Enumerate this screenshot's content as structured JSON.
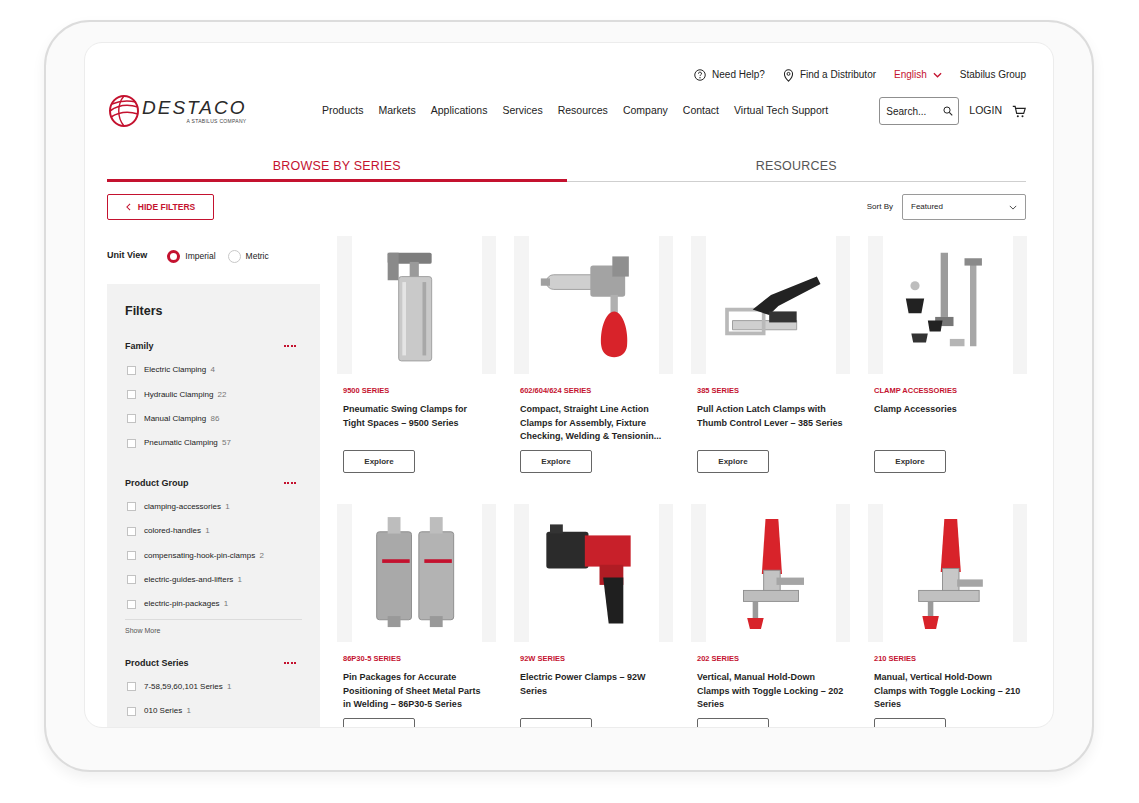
{
  "utility_bar": {
    "help": "Need Help?",
    "distributor": "Find a Distributor",
    "language": "English",
    "group": "Stabilus Group"
  },
  "logo": {
    "name": "DESTACO",
    "tagline": "A STABILUS COMPANY"
  },
  "nav": [
    "Products",
    "Markets",
    "Applications",
    "Services",
    "Resources",
    "Company",
    "Contact",
    "Virtual Tech Support"
  ],
  "search": {
    "placeholder": "Search..."
  },
  "login": "LOGIN",
  "tabs": [
    {
      "label": "BROWSE BY SERIES",
      "selected": true
    },
    {
      "label": "RESOURCES",
      "selected": false
    }
  ],
  "hide_filters": "HIDE FILTERS",
  "sort": {
    "label": "Sort By",
    "value": "Featured"
  },
  "unit_view": {
    "label": "Unit View",
    "options": [
      {
        "label": "Imperial",
        "selected": true
      },
      {
        "label": "Metric",
        "selected": false
      }
    ]
  },
  "filters": {
    "title": "Filters",
    "groups": [
      {
        "title": "Family",
        "items": [
          {
            "label": "Electric Clamping",
            "count": "4",
            "checked": false
          },
          {
            "label": "Hydraulic Clamping",
            "count": "22",
            "checked": false
          },
          {
            "label": "Manual Clamping",
            "count": "86",
            "checked": false
          },
          {
            "label": "Pneumatic Clamping",
            "count": "57",
            "checked": false
          }
        ]
      },
      {
        "title": "Product Group",
        "show_more": "Show More",
        "items": [
          {
            "label": "clamping-accessories",
            "count": "1",
            "checked": false
          },
          {
            "label": "colored-handles",
            "count": "1",
            "checked": false
          },
          {
            "label": "compensating-hook-pin-clamps",
            "count": "2",
            "checked": false
          },
          {
            "label": "electric-guides-and-lifters",
            "count": "1",
            "checked": false
          },
          {
            "label": "electric-pin-packages",
            "count": "1",
            "checked": false
          }
        ]
      },
      {
        "title": "Product Series",
        "items": [
          {
            "label": "7-58,59,60,101 Series",
            "count": "1",
            "checked": false
          },
          {
            "label": "010 Series",
            "count": "1",
            "checked": false
          }
        ]
      }
    ]
  },
  "products": [
    {
      "series": "9500 SERIES",
      "title": "Pneumatic Swing Clamps for Tight Spaces – 9500 Series",
      "button": "Explore"
    },
    {
      "series": "602/604/624 SERIES",
      "title": "Compact, Straight Line Action Clamps for Assembly, Fixture Checking, Welding & Tensionin...",
      "button": "Explore"
    },
    {
      "series": "385 SERIES",
      "title": "Pull Action Latch Clamps with Thumb Control Lever – 385 Series",
      "button": "Explore"
    },
    {
      "series": "CLAMP ACCESSORIES",
      "title": "Clamp Accessories",
      "button": "Explore"
    },
    {
      "series": "86P30-5 SERIES",
      "title": "Pin Packages for Accurate Positioning of Sheet Metal Parts in Welding – 86P30-5 Series"
    },
    {
      "series": "92W SERIES",
      "title": "Electric Power Clamps – 92W Series"
    },
    {
      "series": "202 SERIES",
      "title": "Vertical, Manual Hold-Down Clamps with Toggle Locking – 202 Series"
    },
    {
      "series": "210 SERIES",
      "title": "Manual, Vertical Hold-Down Clamps with Toggle Locking – 210 Series"
    }
  ]
}
